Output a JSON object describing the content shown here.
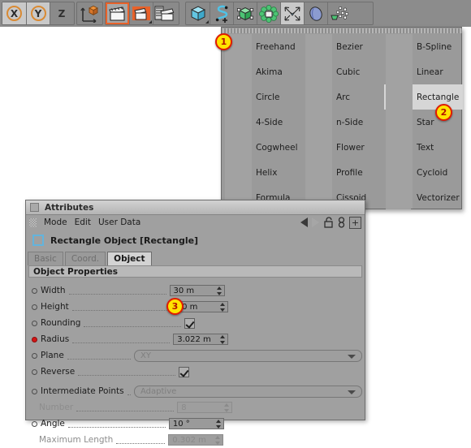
{
  "toolbar": {
    "axis_group": [
      {
        "name": "x-axis-toggle",
        "label": "X",
        "active": true
      },
      {
        "name": "y-axis-toggle",
        "label": "Y",
        "active": true
      },
      {
        "name": "z-axis-toggle",
        "label": "Z",
        "active": false
      }
    ],
    "world_axis": {
      "name": "world-object-axis-toggle",
      "label": ""
    },
    "render_group": [
      {
        "name": "render-view-button",
        "label": "Render View",
        "selected": true
      },
      {
        "name": "render-region-button",
        "label": "Render Region",
        "selected": false
      },
      {
        "name": "render-settings-button",
        "label": "Render Settings",
        "selected": false
      }
    ],
    "object_group": [
      {
        "name": "primitive-cube-button",
        "label": "Cube"
      },
      {
        "name": "spline-tools-button",
        "label": "Spline"
      },
      {
        "name": "generators-button",
        "label": "Generators"
      },
      {
        "name": "deformers-button",
        "label": "Deformers"
      },
      {
        "name": "scene-objects-button",
        "label": "Scene"
      },
      {
        "name": "environment-button",
        "label": "Environment"
      },
      {
        "name": "particles-button",
        "label": "Particles"
      }
    ]
  },
  "spline_menu": {
    "columns": [
      {
        "items": [
          {
            "label": "Freehand",
            "icon": "freehand-spline-icon",
            "selected": true
          },
          {
            "label": "Akima",
            "icon": "akima-spline-icon",
            "selected": false
          },
          {
            "label": "Circle",
            "icon": "circle-spline-icon",
            "selected": false
          },
          {
            "label": "4-Side",
            "icon": "four-side-spline-icon",
            "selected": false
          },
          {
            "label": "Cogwheel",
            "icon": "cogwheel-spline-icon",
            "selected": false
          },
          {
            "label": "Helix",
            "icon": "helix-spline-icon",
            "selected": false
          },
          {
            "label": "Formula",
            "icon": "formula-spline-icon",
            "selected": false
          }
        ]
      },
      {
        "items": [
          {
            "label": "Bezier",
            "icon": "bezier-spline-icon",
            "selected": false
          },
          {
            "label": "Cubic",
            "icon": "cubic-spline-icon",
            "selected": false
          },
          {
            "label": "Arc",
            "icon": "arc-spline-icon",
            "selected": false
          },
          {
            "label": "n-Side",
            "icon": "n-side-spline-icon",
            "selected": false
          },
          {
            "label": "Flower",
            "icon": "flower-spline-icon",
            "selected": false
          },
          {
            "label": "Profile",
            "icon": "profile-spline-icon",
            "selected": false
          },
          {
            "label": "Cissoid",
            "icon": "cissoid-spline-icon",
            "selected": false
          }
        ]
      },
      {
        "items": [
          {
            "label": "B-Spline",
            "icon": "b-spline-icon",
            "selected": false
          },
          {
            "label": "Linear",
            "icon": "linear-spline-icon",
            "selected": false
          },
          {
            "label": "Rectangle",
            "icon": "rectangle-spline-icon",
            "selected": false,
            "highlighted": true
          },
          {
            "label": "Star",
            "icon": "star-spline-icon",
            "selected": false
          },
          {
            "label": "Text",
            "icon": "text-spline-icon",
            "selected": false
          },
          {
            "label": "Cycloid",
            "icon": "cycloid-spline-icon",
            "selected": false
          },
          {
            "label": "Vectorizer",
            "icon": "vectorizer-spline-icon",
            "selected": false
          }
        ]
      }
    ]
  },
  "attributes": {
    "title": "Attributes",
    "menus": [
      "Mode",
      "Edit",
      "User Data"
    ],
    "object_name": "Rectangle Object [Rectangle]",
    "tabs": [
      {
        "label": "Basic",
        "active": false
      },
      {
        "label": "Coord.",
        "active": false
      },
      {
        "label": "Object",
        "active": true
      }
    ],
    "section_title": "Object Properties",
    "properties": [
      {
        "label": "Width",
        "value": "30 m",
        "type": "number",
        "enabled": true,
        "marker": "ring"
      },
      {
        "label": "Height",
        "value": "30 m",
        "type": "number",
        "enabled": true,
        "marker": "ring"
      },
      {
        "label": "Rounding",
        "value": "",
        "type": "checkbox",
        "enabled": true,
        "marker": "ring",
        "checked": true
      },
      {
        "label": "Radius",
        "value": "3.022 m",
        "type": "number",
        "enabled": true,
        "marker": "red"
      },
      {
        "label": "Plane",
        "value": "XY",
        "type": "select",
        "enabled": true,
        "marker": "ring"
      },
      {
        "label": "Reverse",
        "value": "",
        "type": "checkbox",
        "enabled": true,
        "marker": "ring",
        "checked": true
      },
      {
        "label": "Intermediate Points",
        "value": "Adaptive",
        "type": "select",
        "enabled": true,
        "marker": "ring"
      },
      {
        "label": "Number",
        "value": "8",
        "type": "number",
        "enabled": false,
        "marker": "none"
      },
      {
        "label": "Angle",
        "value": "10 °",
        "type": "number",
        "enabled": true,
        "marker": "ring"
      },
      {
        "label": "Maximum Length",
        "value": "0.302 m",
        "type": "number",
        "enabled": false,
        "marker": "none"
      }
    ]
  },
  "callouts": [
    {
      "number": "1",
      "target": "freehand-menu-item"
    },
    {
      "number": "2",
      "target": "rectangle-menu-item"
    },
    {
      "number": "3",
      "target": "rounding-checkbox"
    }
  ]
}
